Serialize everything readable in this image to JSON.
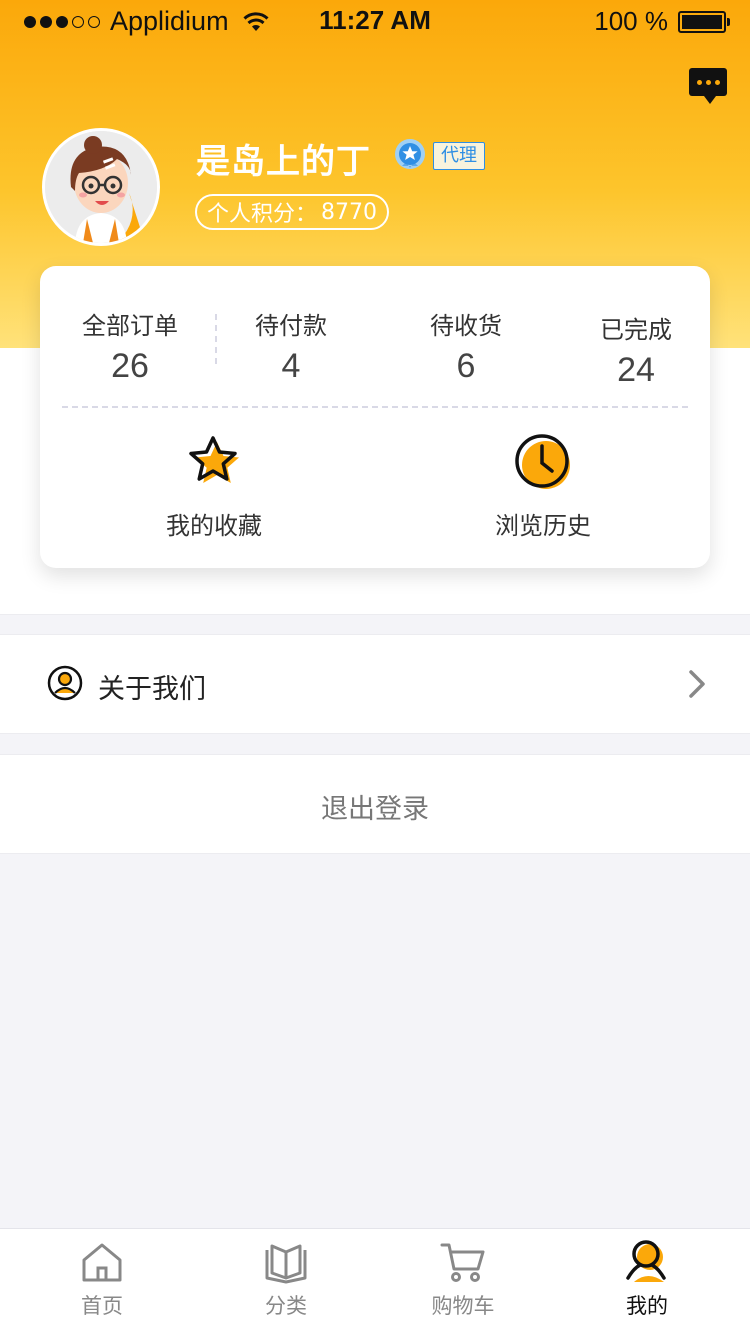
{
  "status_bar": {
    "carrier": "Applidium",
    "time": "11:27 AM",
    "battery": "100 %"
  },
  "profile": {
    "name": "是岛上的丁",
    "role_tag": "代理",
    "points_label": "个人积分：",
    "points_value": "8770"
  },
  "orders": [
    {
      "label": "全部订单",
      "count": "26"
    },
    {
      "label": "待付款",
      "count": "4"
    },
    {
      "label": "待收货",
      "count": "6"
    },
    {
      "label": "已完成",
      "count": "24"
    }
  ],
  "quick_links": [
    {
      "label": "我的收藏",
      "icon": "star-icon"
    },
    {
      "label": "浏览历史",
      "icon": "clock-icon"
    }
  ],
  "menu": {
    "about": "关于我们",
    "logout": "退出登录"
  },
  "tabs": [
    {
      "label": "首页",
      "icon": "home-icon"
    },
    {
      "label": "分类",
      "icon": "book-icon"
    },
    {
      "label": "购物车",
      "icon": "cart-icon"
    },
    {
      "label": "我的",
      "icon": "profile-icon",
      "active": true
    }
  ],
  "colors": {
    "accent": "#fba80a",
    "accent_light": "#ffe27a",
    "tag_blue": "#2f8fe4"
  }
}
